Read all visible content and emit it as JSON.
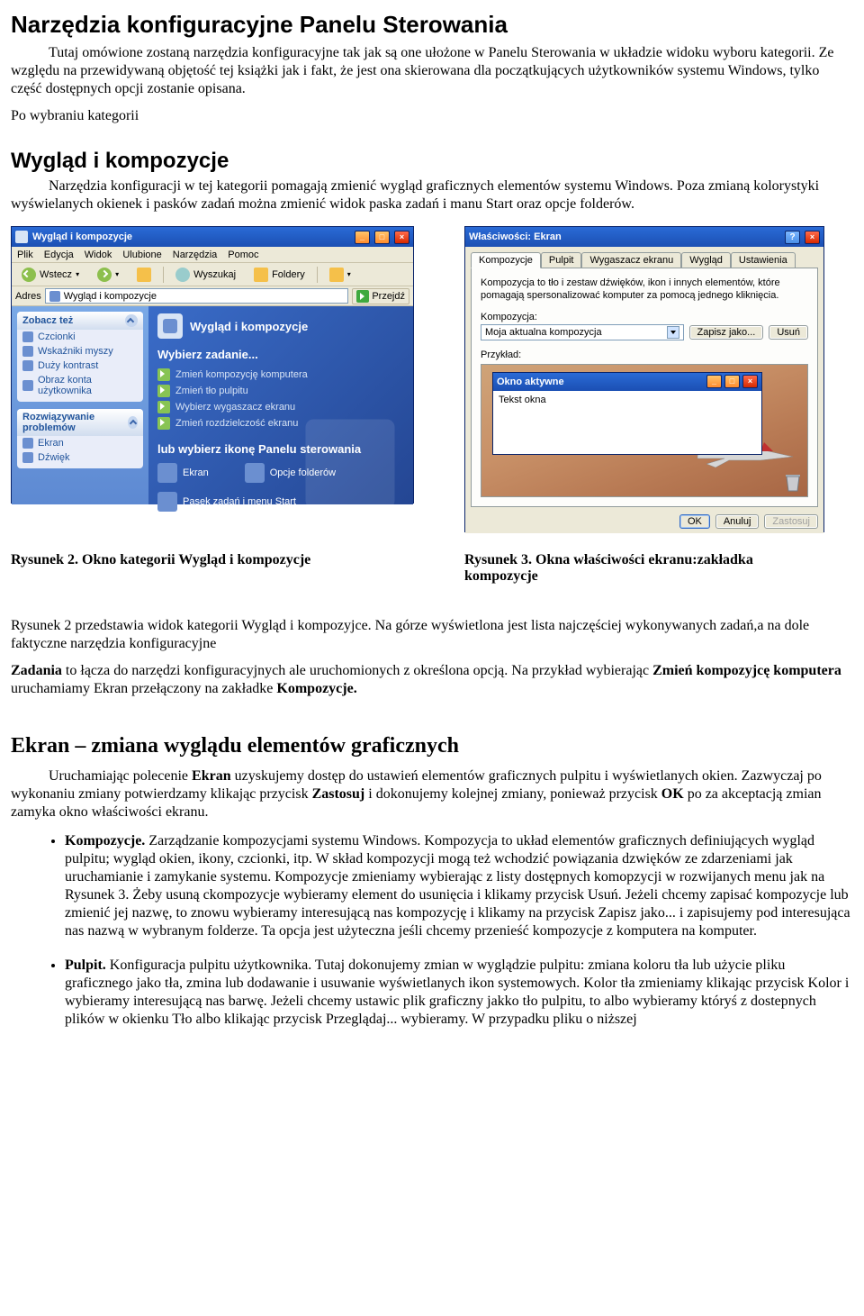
{
  "doc": {
    "h1": "Narzędzia konfiguracyjne Panelu Sterowania",
    "intro1": "Tutaj omówione zostaną narzędzia konfiguracyjne tak jak są one ułożone w Panelu Sterowania w układzie widoku wyboru kategorii. Ze względu na przewidywaną objętość tej książki jak i fakt, że jest ona skierowana dla początkujących użytkowników systemu Windows, tylko część dostępnych opcji zostanie opisana.",
    "intro2": "Po wybraniu kategorii",
    "h2a": "Wygląd i kompozycje",
    "sec_a_p": "Narzędzia konfiguracji w tej kategorii pomagają zmienić wygląd graficznych elementów systemu Windows. Poza zmianą kolorystyki wyświelanych okienek i pasków zadań można zmienić widok paska zadań i manu Start oraz opcje folderów.",
    "cap1": "Rysunek 2. Okno kategorii Wygląd i kompozycje",
    "cap2_a": "Rysunek 3.",
    "cap2_b": " Okna właściwości ekranu:zakładka kompozycje",
    "para2": "Rysunek 2 przedstawia widok kategorii Wygląd i kompozyjce. Na górze wyświetlona jest lista najczęściej wykonywanych zadań,a na dole faktyczne narzędzia konfiguracyjne",
    "para3a": "Zadania",
    "para3b": " to łącza do narzędzi konfiguracyjnych ale uruchomionych z określona opcją. Na przykład wybierając ",
    "para3c": "Zmień kompozyjcę komputera",
    "para3d": " uruchamiamy Ekran przełączony na zakładke ",
    "para3e": "Kompozycje.",
    "h2b": "Ekran – zmiana wyglądu elementów graficznych",
    "sec_b_p1a": "Uruchamiając polecenie ",
    "sec_b_p1b": "Ekran",
    "sec_b_p1c": " uzyskujemy dostęp do ustawień elementów graficznych pulpitu i wyświetlanych okien. Zazwyczaj po wykonaniu zmiany potwierdzamy klikając przycisk ",
    "sec_b_p1d": "Zastosuj",
    "sec_b_p1e": " i dokonujemy kolejnej zmiany, ponieważ przycisk ",
    "sec_b_p1f": "OK",
    "sec_b_p1g": " po za akceptacją zmian zamyka okno właściwości ekranu.",
    "bullets": [
      {
        "b": "Kompozycje.",
        "t": " Zarządzanie kompozycjami systemu Windows. Kompozycja to układ elementów graficznych definiujących wygląd pulpitu; wygląd okien, ikony, czcionki, itp. W skład kompozycji mogą też wchodzić powiązania dzwięków ze zdarzeniami jak uruchamianie i zamykanie systemu. Kompozycje zmieniamy wybierając z listy dostępnych komopzycji w rozwijanych menu jak na Rysunek 3. Żeby usuną ckompozycje wybieramy element do usunięcia i klikamy przycisk Usuń. Jeżeli chcemy zapisać kompozycje lub zmienić jej nazwę, to znowu wybieramy interesującą nas kompozycję i klikamy na przycisk Zapisz jako... i zapisujemy pod interesująca nas nazwą w wybranym folderze. Ta opcja jest użyteczna jeśli chcemy przenieść kompozycje z komputera na komputer."
      },
      {
        "b": "Pulpit.",
        "t": " Konfiguracja pulpitu użytkownika. Tutaj dokonujemy zmian w wyglądzie pulpitu: zmiana koloru tła lub użycie pliku graficznego jako tła, zmina lub dodawanie i usuwanie wyświetlanych ikon systemowych. Kolor tła zmieniamy klikając przycisk Kolor i wybieramy interesującą nas barwę. Jeżeli chcemy ustawic plik graficzny jakko tło pulpitu, to albo wybieramy któryś z dostepnych plików w okienku Tło albo klikając przycisk Przeglądaj... wybieramy. W przypadku pliku o niższej"
      }
    ]
  },
  "win1": {
    "title": "Wygląd i kompozycje",
    "menus": [
      "Plik",
      "Edycja",
      "Widok",
      "Ulubione",
      "Narzędzia",
      "Pomoc"
    ],
    "toolbar_back": "Wstecz",
    "toolbar_search": "Wyszukaj",
    "toolbar_folders": "Foldery",
    "addr_label": "Adres",
    "addr_value": "Wygląd i kompozycje",
    "go": "Przejdź",
    "side_see_also": "Zobacz też",
    "side_items1": [
      "Czcionki",
      "Wskaźniki myszy",
      "Duży kontrast",
      "Obraz konta użytkownika"
    ],
    "side_trouble": "Rozwiązywanie problemów",
    "side_items2": [
      "Ekran",
      "Dźwięk"
    ],
    "main_title": "Wygląd i kompozycje",
    "pick_task": "Wybierz zadanie...",
    "tasks": [
      "Zmień kompozycję komputera",
      "Zmień tło pulpitu",
      "Wybierz wygaszacz ekranu",
      "Zmień rozdzielczość ekranu"
    ],
    "or_pick": "lub wybierz ikonę Panelu sterowania",
    "icon1": "Ekran",
    "icon2": "Opcje folderów",
    "icon3": "Pasek zadań i menu Start"
  },
  "win2": {
    "title": "Właściwości: Ekran",
    "tabs": [
      "Kompozycje",
      "Pulpit",
      "Wygaszacz ekranu",
      "Wygląd",
      "Ustawienia"
    ],
    "desc": "Kompozycja to tło i zestaw dźwięków, ikon i innych elementów, które pomagają spersonalizować komputer za pomocą jednego kliknięcia.",
    "select_label": "Kompozycja:",
    "select_value": "Moja aktualna kompozycja",
    "save_as": "Zapisz jako...",
    "delete": "Usuń",
    "preview_label": "Przykład:",
    "active_win": "Okno aktywne",
    "active_body": "Tekst okna",
    "ok": "OK",
    "cancel": "Anuluj",
    "apply": "Zastosuj"
  }
}
